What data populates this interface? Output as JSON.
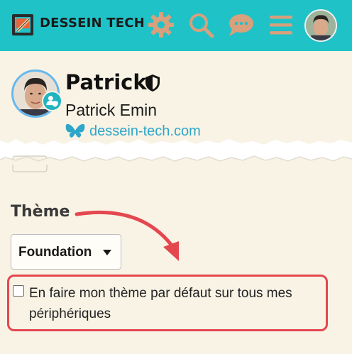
{
  "header": {
    "brand": "DESSEIN TECH",
    "icons": [
      "gear-icon",
      "search-icon",
      "chat-icon",
      "hamburger-menu-icon"
    ],
    "background": "#1fc2c7"
  },
  "profile": {
    "username": "Patrick",
    "full_name": "Patrick Emin",
    "website": "dessein-tech.com",
    "badge_icon": "shield-icon"
  },
  "theme": {
    "section_title": "Thème",
    "selected": "Foundation",
    "checkbox_label": "En faire mon thème par défaut sur tous mes périphériques",
    "checkbox_checked": false
  },
  "annotation": {
    "color": "#e4474f"
  }
}
